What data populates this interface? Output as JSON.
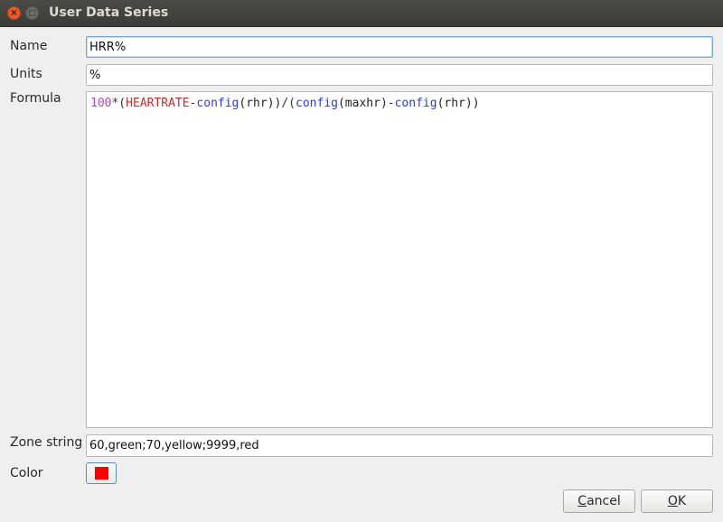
{
  "window": {
    "title": "User Data Series",
    "close_glyph": "×",
    "maximize_glyph": "□"
  },
  "form": {
    "name_label": "Name",
    "name_value": "HRR%",
    "units_label": "Units",
    "units_value": "%",
    "formula_label": "Formula",
    "formula_tokens": [
      {
        "type": "number",
        "text": "100"
      },
      {
        "type": "op",
        "text": "*("
      },
      {
        "type": "symbol",
        "text": "HEARTRATE"
      },
      {
        "type": "op",
        "text": "-"
      },
      {
        "type": "func",
        "text": "config"
      },
      {
        "type": "text",
        "text": "(rhr))"
      },
      {
        "type": "op",
        "text": "/("
      },
      {
        "type": "func",
        "text": "config"
      },
      {
        "type": "text",
        "text": "(maxhr)"
      },
      {
        "type": "op",
        "text": "-"
      },
      {
        "type": "func",
        "text": "config"
      },
      {
        "type": "text",
        "text": "(rhr))"
      }
    ],
    "zone_label": "Zone string",
    "zone_value": "60,green;70,yellow;9999,red",
    "color_label": "Color",
    "color_value": "#ff0000"
  },
  "buttons": {
    "cancel_first": "C",
    "cancel_rest": "ancel",
    "ok_first": "O",
    "ok_rest": "K"
  }
}
